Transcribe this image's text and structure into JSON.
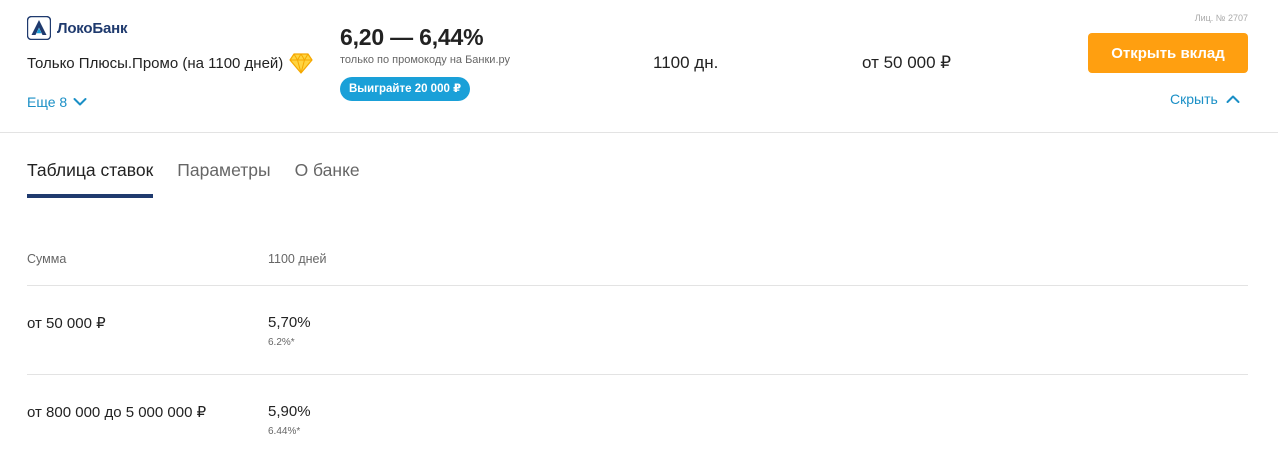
{
  "bank": {
    "name": "ЛокоБанк",
    "logo_icon": "lokobank-logo-icon",
    "brand_color": "#1f3a6e"
  },
  "product": {
    "name": "Только Плюсы.Промо (на 1100 дней)",
    "badge_icon": "diamond-icon",
    "more_label": "Еще 8"
  },
  "offer": {
    "rate": "6,20 — 6,44%",
    "rate_note": "только по промокоду на Банки.ру",
    "promo_badge": "Выиграйте 20 000 ₽",
    "term": "1100 дн.",
    "min_sum": "от 50 000 ₽",
    "license": "Лиц. № 2707",
    "open_button": "Открыть вклад",
    "hide_label": "Скрыть"
  },
  "colors": {
    "accent": "#ff9f10",
    "link": "#1a8fc6",
    "badge": "#1aa0d8"
  },
  "tabs": [
    {
      "label": "Таблица ставок",
      "active": true
    },
    {
      "label": "Параметры",
      "active": false
    },
    {
      "label": "О банке",
      "active": false
    }
  ],
  "rates_table": {
    "headers": [
      "Сумма",
      "1100 дней"
    ],
    "rows": [
      {
        "amount": "от 50 000 ₽",
        "rate": "5,70%",
        "promo_rate": "6.2%*"
      },
      {
        "amount": "от 800 000 до 5 000 000 ₽",
        "rate": "5,90%",
        "promo_rate": "6.44%*"
      }
    ]
  }
}
